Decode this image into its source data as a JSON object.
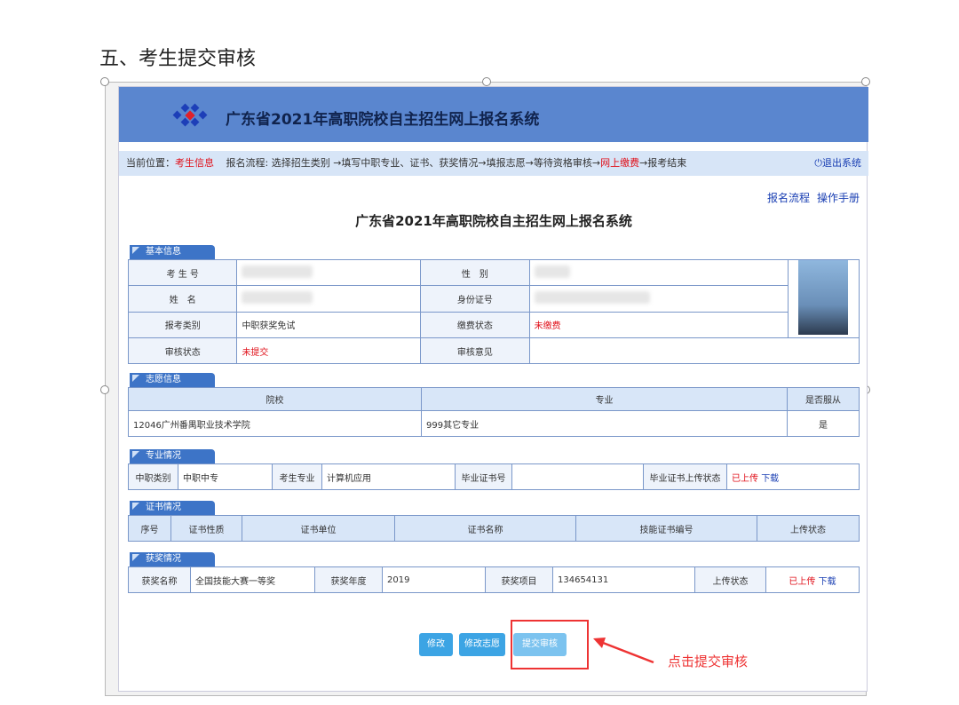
{
  "doc_heading": "五、考生提交审核",
  "app": {
    "banner_title": "广东省2021年高职院校自主招生网上报名系统",
    "page_title": "广东省2021年高职院校自主招生网上报名系统"
  },
  "navbar": {
    "position_label": "当前位置：",
    "position_value": "考生信息",
    "flow_prefix": "报名流程: 选择招生类别 →填写中职专业、证书、获奖情况→填报志愿→等待资格审核→",
    "flow_payment": "网上缴费",
    "flow_suffix": "→报考结束",
    "logout": "退出系统"
  },
  "links": {
    "process": "报名流程",
    "manual": "操作手册"
  },
  "basic_info": {
    "section": "基本信息",
    "exam_no_label": "考 生 号",
    "gender_label": "性　别",
    "name_label": "姓　名",
    "id_label": "身份证号",
    "category_label": "报考类别",
    "category_value": "中职获奖免试",
    "payment_label": "缴费状态",
    "payment_value": "未缴费",
    "review_label": "审核状态",
    "review_value": "未提交",
    "opinion_label": "审核意见"
  },
  "wish_info": {
    "section": "志愿信息",
    "headers": [
      "院校",
      "专业",
      "是否服从"
    ],
    "row": [
      "12046广州番禺职业技术学院",
      "999其它专业",
      "是"
    ]
  },
  "major_info": {
    "section": "专业情况",
    "cells": [
      "中职类别",
      "中职中专",
      "考生专业",
      "计算机应用",
      "毕业证书号",
      "",
      "毕业证书上传状态"
    ],
    "uploaded": "已上传",
    "download": "下载"
  },
  "cert_info": {
    "section": "证书情况",
    "headers": [
      "序号",
      "证书性质",
      "证书单位",
      "证书名称",
      "技能证书编号",
      "上传状态"
    ]
  },
  "award_info": {
    "section": "获奖情况",
    "cells": [
      "获奖名称",
      "全国技能大赛一等奖",
      "获奖年度",
      "2019",
      "获奖项目",
      "134654131",
      "上传状态"
    ],
    "uploaded": "已上传",
    "download": "下载"
  },
  "buttons": {
    "modify": "修改",
    "modify_wish": "修改志愿",
    "submit": "提交审核"
  },
  "callout": "点击提交审核"
}
